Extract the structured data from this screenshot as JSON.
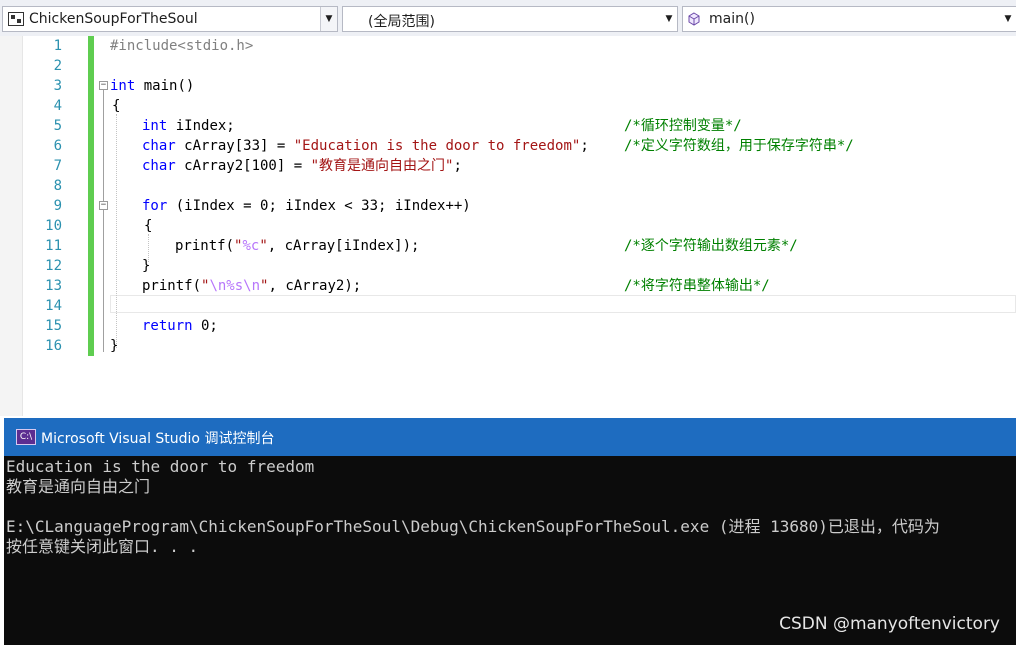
{
  "nav": {
    "project": "ChickenSoupForTheSoul",
    "scope": "(全局范围)",
    "member": "main()"
  },
  "code": {
    "lines": [
      {
        "num": "1",
        "text": "#include<stdio.h>"
      },
      {
        "num": "2",
        "text": ""
      },
      {
        "num": "3",
        "text": "int main()"
      },
      {
        "num": "4",
        "text": "{"
      },
      {
        "num": "5",
        "text": "int iIndex;",
        "comment": "/*循环控制变量*/"
      },
      {
        "num": "6",
        "text": "char cArray[33] = \"Education is the door to freedom\";",
        "comment": "/*定义字符数组，用于保存字符串*/"
      },
      {
        "num": "7",
        "text": "char cArray2[100] = \"教育是通向自由之门\";"
      },
      {
        "num": "8",
        "text": ""
      },
      {
        "num": "9",
        "text": "for (iIndex = 0; iIndex < 33; iIndex++)"
      },
      {
        "num": "10",
        "text": "{"
      },
      {
        "num": "11",
        "text": "printf(\"%c\", cArray[iIndex]);",
        "comment": "/*逐个字符输出数组元素*/"
      },
      {
        "num": "12",
        "text": "}"
      },
      {
        "num": "13",
        "text": "printf(\"\\n%s\\n\", cArray2);",
        "comment": "/*将字符串整体输出*/"
      },
      {
        "num": "14",
        "text": ""
      },
      {
        "num": "15",
        "text": "return 0;"
      },
      {
        "num": "16",
        "text": "}"
      }
    ]
  },
  "console": {
    "title": "Microsoft Visual Studio 调试控制台",
    "icon_label": "C:\\",
    "output": [
      "Education is the door to freedom",
      "教育是通向自由之门",
      "",
      "E:\\CLanguageProgram\\ChickenSoupForTheSoul\\Debug\\ChickenSoupForTheSoul.exe (进程 13680)已退出，代码为",
      "按任意键关闭此窗口. . ."
    ],
    "watermark": "CSDN @manyoftenvictory"
  },
  "colors": {
    "keyword": "#0000ff",
    "string": "#a31515",
    "comment": "#008000",
    "line_number": "#2b91af",
    "change_bar": "#5fcd50",
    "console_title_bg": "#1e6cc0",
    "console_bg": "#0c0c0c"
  },
  "icons": [
    "project-icon",
    "dropdown-arrow-icon",
    "method-icon",
    "fold-toggle-icon",
    "console-app-icon"
  ]
}
